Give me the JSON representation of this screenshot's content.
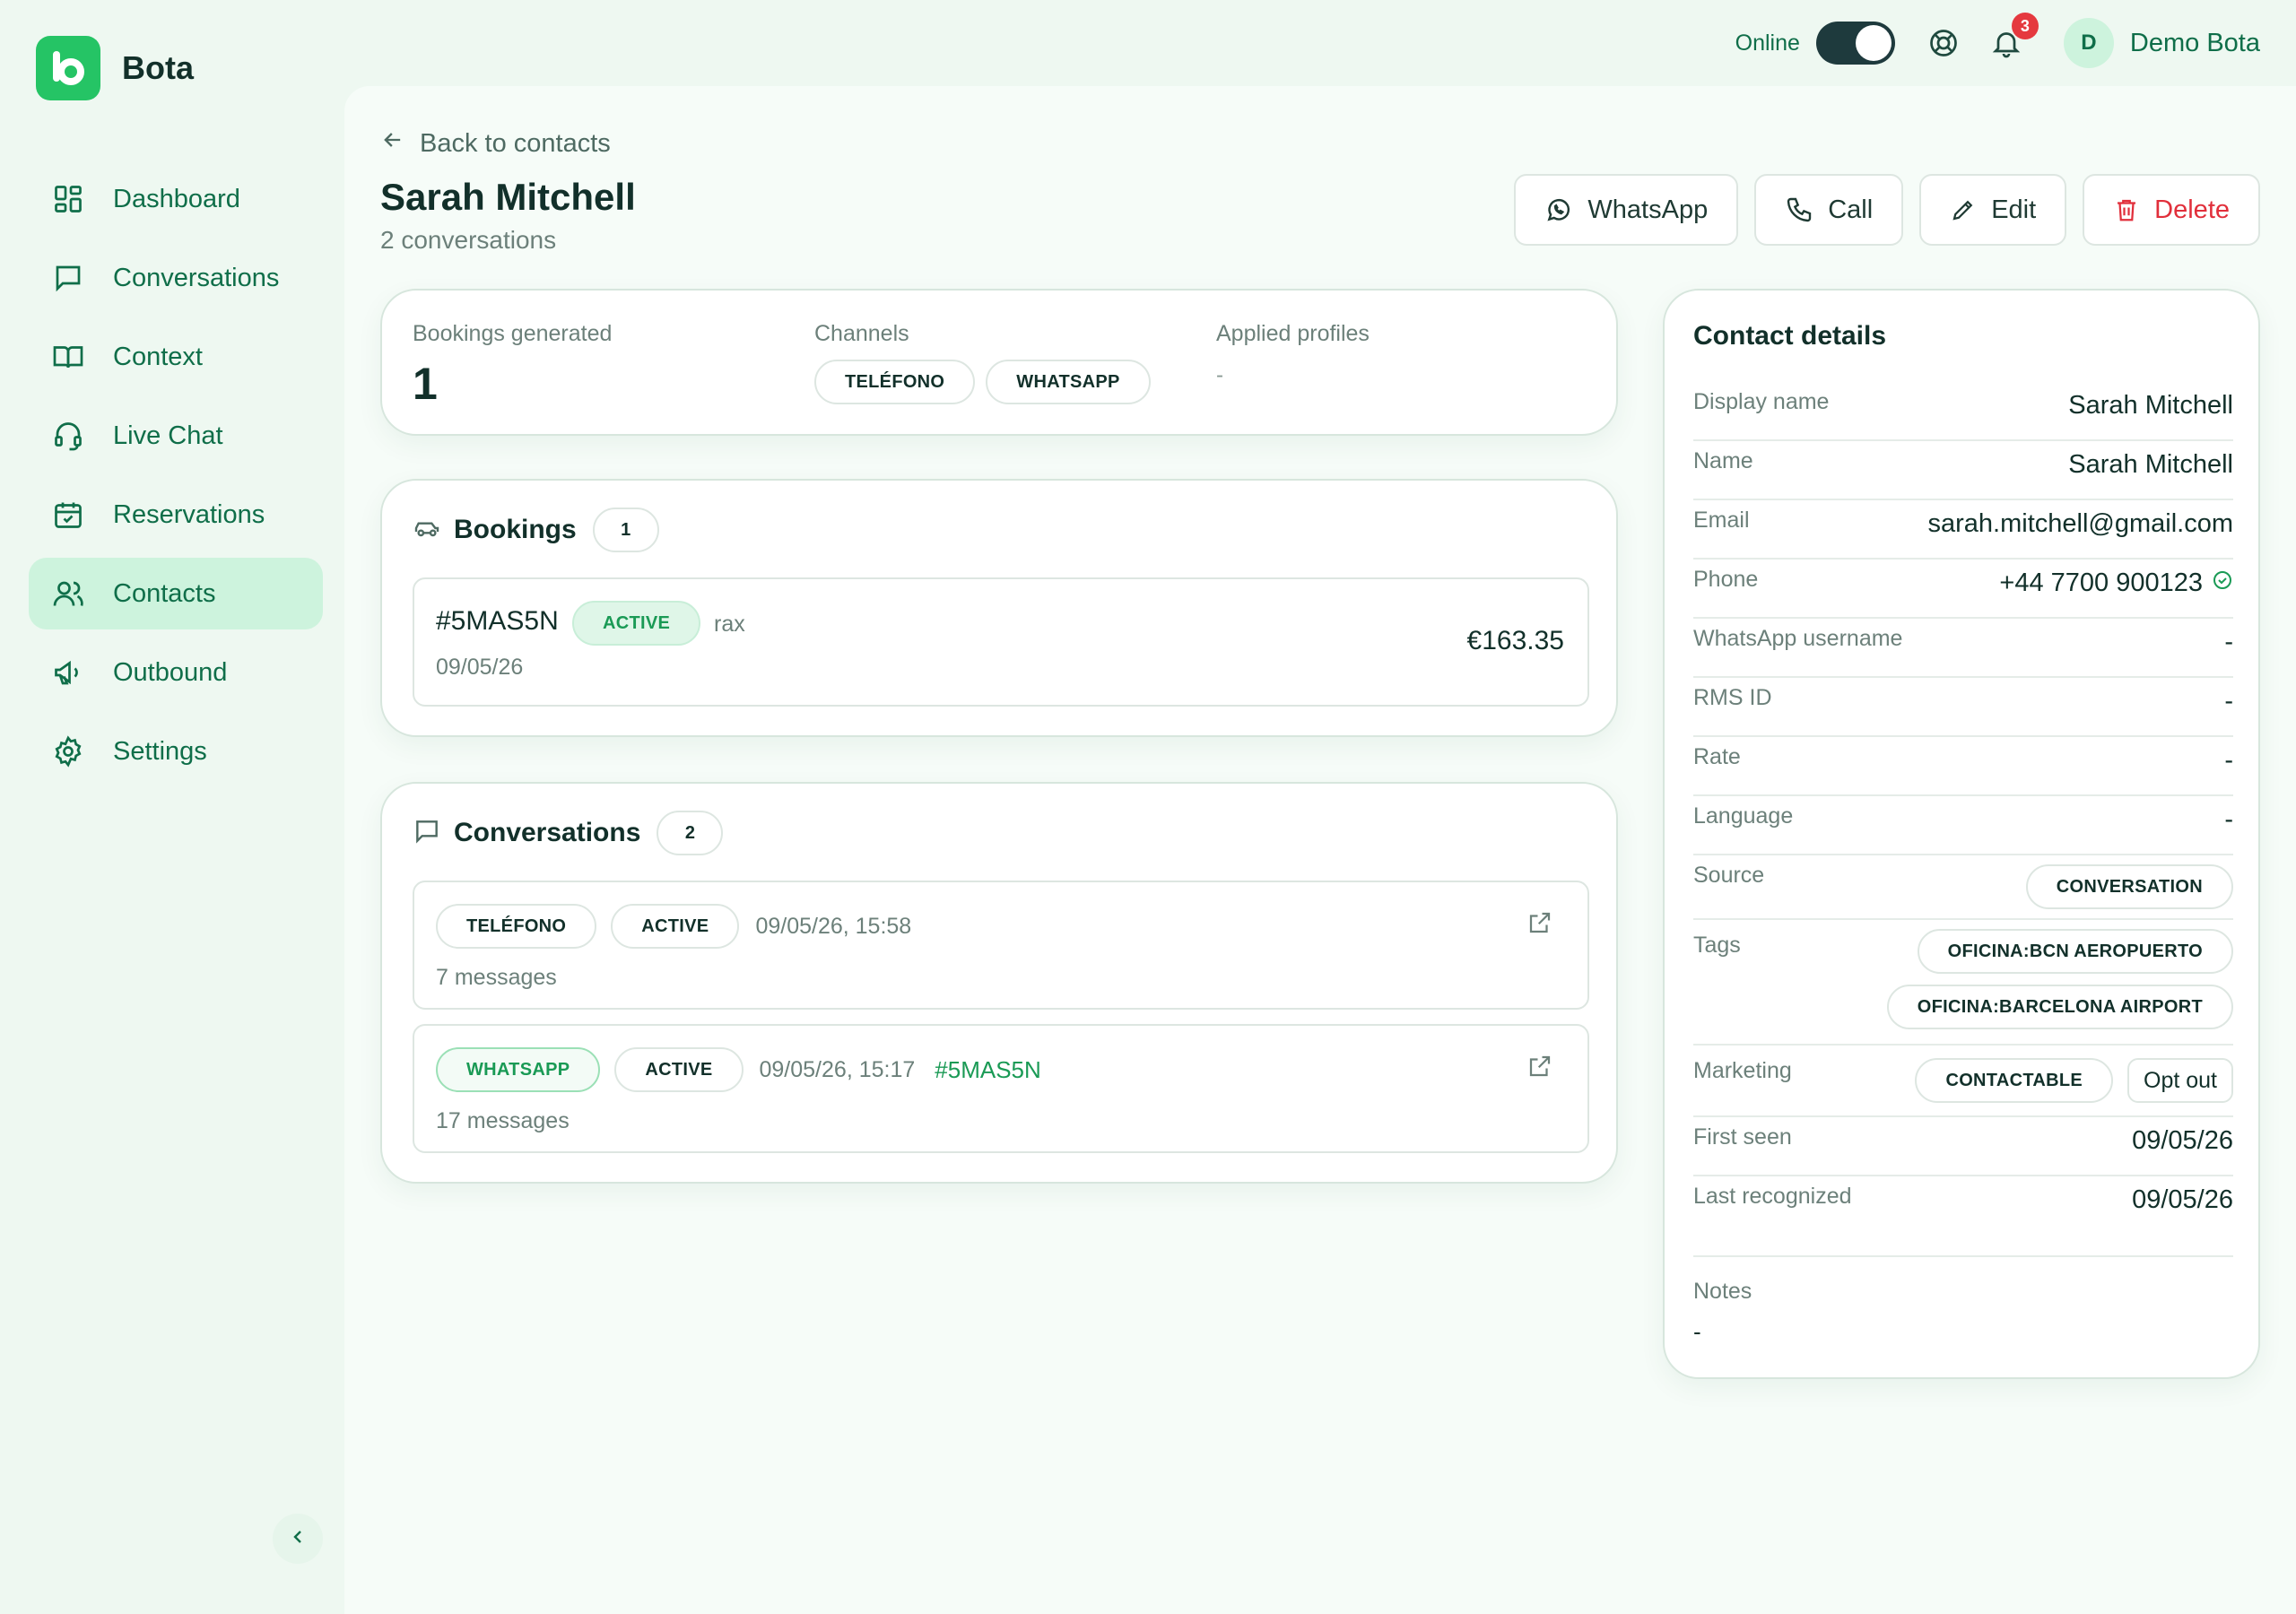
{
  "brand": {
    "name": "Bota"
  },
  "sidebar": {
    "items": [
      {
        "label": "Dashboard",
        "icon": "dashboard-icon"
      },
      {
        "label": "Conversations",
        "icon": "chat-icon"
      },
      {
        "label": "Context",
        "icon": "book-icon"
      },
      {
        "label": "Live Chat",
        "icon": "headset-icon"
      },
      {
        "label": "Reservations",
        "icon": "calendar-check-icon"
      },
      {
        "label": "Contacts",
        "icon": "users-icon",
        "active": true
      },
      {
        "label": "Outbound",
        "icon": "megaphone-icon"
      },
      {
        "label": "Settings",
        "icon": "gear-icon"
      }
    ]
  },
  "topbar": {
    "online_label": "Online",
    "online": true,
    "notifications_count": "3",
    "user_initial": "D",
    "user_name": "Demo Bota"
  },
  "page": {
    "back_label": "Back to contacts",
    "title": "Sarah Mitchell",
    "subtitle": "2 conversations"
  },
  "actions": {
    "whatsapp": "WhatsApp",
    "call": "Call",
    "edit": "Edit",
    "delete": "Delete"
  },
  "stats": {
    "bookings_label": "Bookings generated",
    "bookings_value": "1",
    "channels_label": "Channels",
    "channels": [
      "TELÉFONO",
      "WHATSAPP"
    ],
    "profiles_label": "Applied profiles",
    "profiles_value": "-"
  },
  "bookings": {
    "title": "Bookings",
    "count": "1",
    "items": [
      {
        "code": "#5MAS5N",
        "status": "ACTIVE",
        "note": "rax",
        "date": "09/05/26",
        "amount": "€163.35"
      }
    ]
  },
  "conversations": {
    "title": "Conversations",
    "count": "2",
    "items": [
      {
        "channel": "TELÉFONO",
        "status": "ACTIVE",
        "datetime": "09/05/26, 15:58",
        "ref": "",
        "messages": "7 messages"
      },
      {
        "channel": "WHATSAPP",
        "status": "ACTIVE",
        "datetime": "09/05/26, 15:17",
        "ref": "#5MAS5N",
        "messages": "17 messages"
      }
    ]
  },
  "details": {
    "title": "Contact details",
    "display_name_label": "Display name",
    "display_name": "Sarah Mitchell",
    "name_label": "Name",
    "name": "Sarah Mitchell",
    "email_label": "Email",
    "email": "sarah.mitchell@gmail.com",
    "phone_label": "Phone",
    "phone": "+44 7700 900123",
    "whatsapp_label": "WhatsApp username",
    "whatsapp": "-",
    "rms_label": "RMS ID",
    "rms": "-",
    "rate_label": "Rate",
    "rate": "-",
    "language_label": "Language",
    "language": "-",
    "source_label": "Source",
    "source": "CONVERSATION",
    "tags_label": "Tags",
    "tags": [
      "OFICINA:BCN AEROPUERTO",
      "OFICINA:BARCELONA AIRPORT"
    ],
    "marketing_label": "Marketing",
    "marketing": "CONTACTABLE",
    "opt_out": "Opt out",
    "first_seen_label": "First seen",
    "first_seen": "09/05/26",
    "last_recognized_label": "Last recognized",
    "last_recognized": "09/05/26",
    "notes_label": "Notes",
    "notes": "-"
  },
  "colors": {
    "accent": "#25c465",
    "text_green": "#0f6e49",
    "danger": "#e12f3b",
    "nav_active": "#cdf3dd"
  }
}
